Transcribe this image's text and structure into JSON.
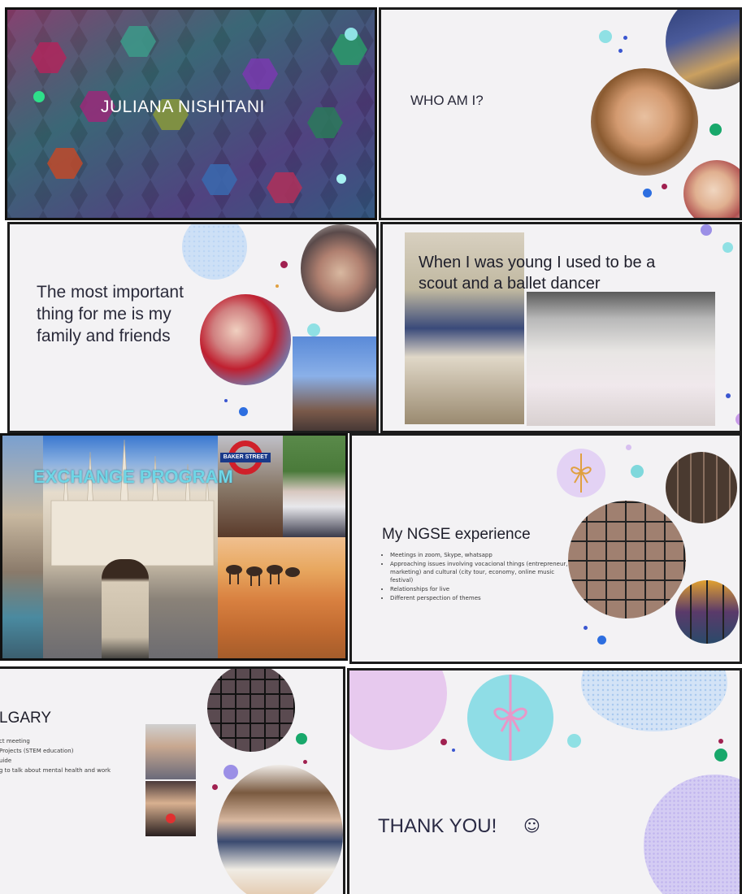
{
  "slides": {
    "title": {
      "name": "JULIANA NISHITANI"
    },
    "who": {
      "heading": "WHO AM I?"
    },
    "family": {
      "heading": "The most important thing for me is my family and friends"
    },
    "young": {
      "heading": "When I was young I used to be a scout and a ballet dancer"
    },
    "exchange": {
      "heading": "EXCHANGE PROGRAM",
      "sign": "BAKER STREET"
    },
    "ngse": {
      "heading": "My NGSE experience",
      "bullets": [
        "Meetings in zoom, Skype, whatsapp",
        "Approaching issues involving vocacional things (entrepreneur, marketing) and cultural (city tour, economy, online music festival)",
        "Relationships for live",
        "Different perspection of themes"
      ]
    },
    "calgary": {
      "heading": "LGARY",
      "bullets": [
        "ct meeting",
        "Projects (STEM education)",
        "uide",
        "g to talk about mental health and work"
      ]
    },
    "thanks": {
      "heading": "THANK YOU!",
      "smile": "☺"
    }
  },
  "colors": {
    "slide_bg": "#f3f2f4",
    "heading_text": "#2e2e3e",
    "accent_teal": "#7fd8dc",
    "accent_green": "#18a86b",
    "accent_blue": "#2d6ee0",
    "accent_purple": "#9b8fe6",
    "accent_pink": "#e7b7ea"
  }
}
